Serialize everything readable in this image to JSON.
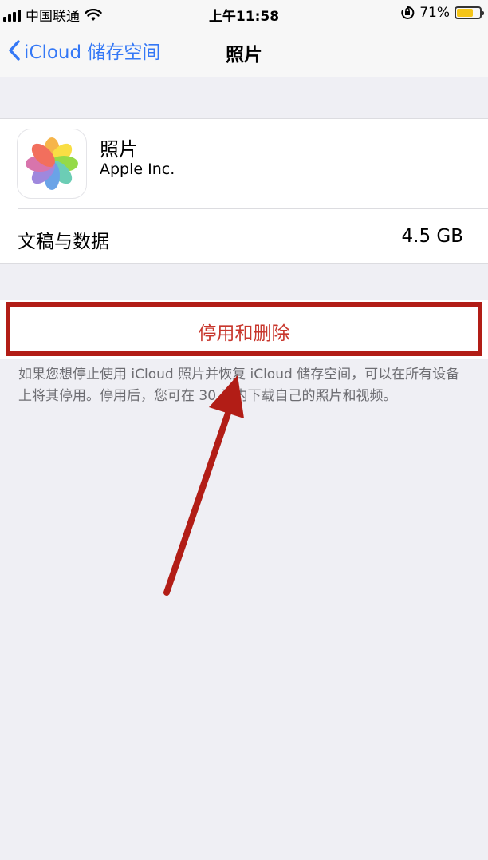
{
  "status_bar": {
    "carrier": "中国联通",
    "time": "上午11:58",
    "battery_percent": "71%",
    "battery_level": 0.71,
    "icons": [
      "signal-icon",
      "wifi-icon",
      "orientation-lock-icon",
      "battery-icon"
    ]
  },
  "nav": {
    "back_label": "iCloud 储存空间",
    "title": "照片"
  },
  "app": {
    "name": "照片",
    "developer": "Apple Inc.",
    "icon": "photos-app-icon"
  },
  "storage_row": {
    "label": "文稿与数据",
    "value": "4.5 GB"
  },
  "disable_button": {
    "label": "停用和删除"
  },
  "footer_note": "如果您想停止使用 iCloud 照片并恢复 iCloud 储存空间，可以在所有设备上将其停用。停用后，您可在 30 天内下载自己的照片和视频。",
  "colors": {
    "accent": "#3478f6",
    "destructive": "#c8372d",
    "highlight_annotation": "#b21d16"
  }
}
